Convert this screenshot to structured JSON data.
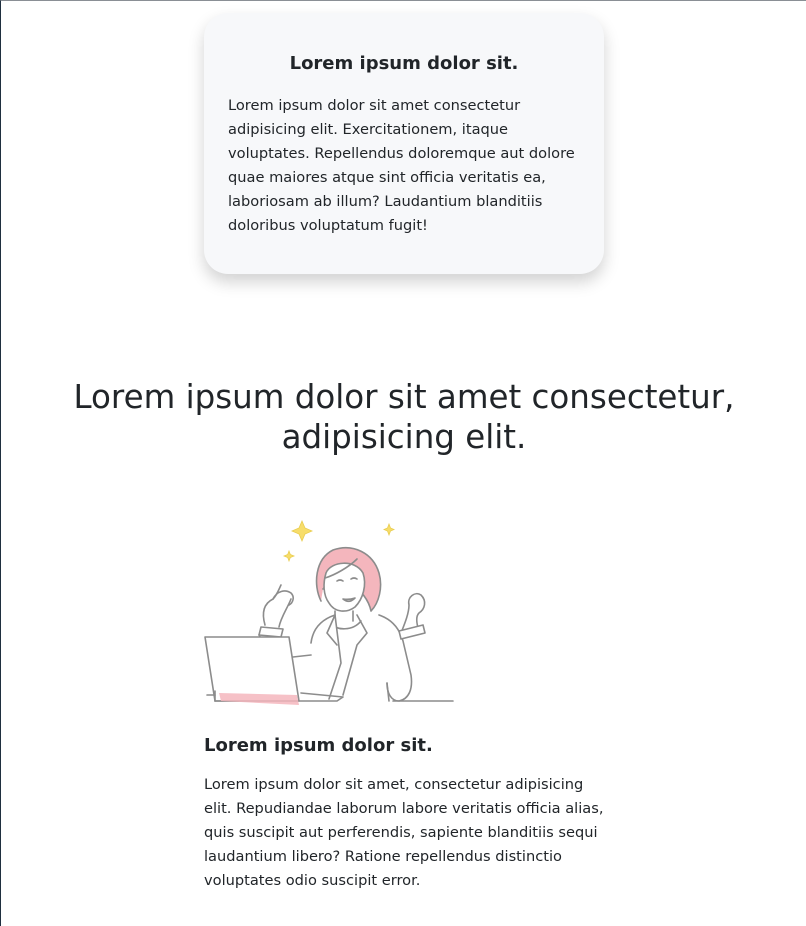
{
  "top_card": {
    "title": "Lorem ipsum dolor sit.",
    "text": "Lorem ipsum dolor sit amet consectetur adipisicing elit. Exercitationem, itaque voluptates. Repellendus doloremque aut dolore quae maiores atque sint officia veritatis ea, laboriosam ab illum? Laudantium blanditiis doloribus voluptatum fugit!"
  },
  "section": {
    "headline": "Lorem ipsum dolor sit amet consectetur, adipisicing elit."
  },
  "feature": {
    "illustration_icon": "woman-celebrating-at-laptop-illustration",
    "title": "Lorem ipsum dolor sit.",
    "text": "Lorem ipsum dolor sit amet, consectetur adipisicing elit. Repudiandae laborum labore veritatis officia alias, quis suscipit aut perferendis, sapiente blanditiis sequi laudantium libero? Ratione repellendus distinctio voluptates odio suscipit error."
  },
  "colors": {
    "card_background": "#f7f8fa",
    "text": "#212529",
    "illustration_line": "#8c8c8c",
    "illustration_accent_pink": "#f4b6bd",
    "illustration_accent_yellow": "#f7dd6a"
  }
}
